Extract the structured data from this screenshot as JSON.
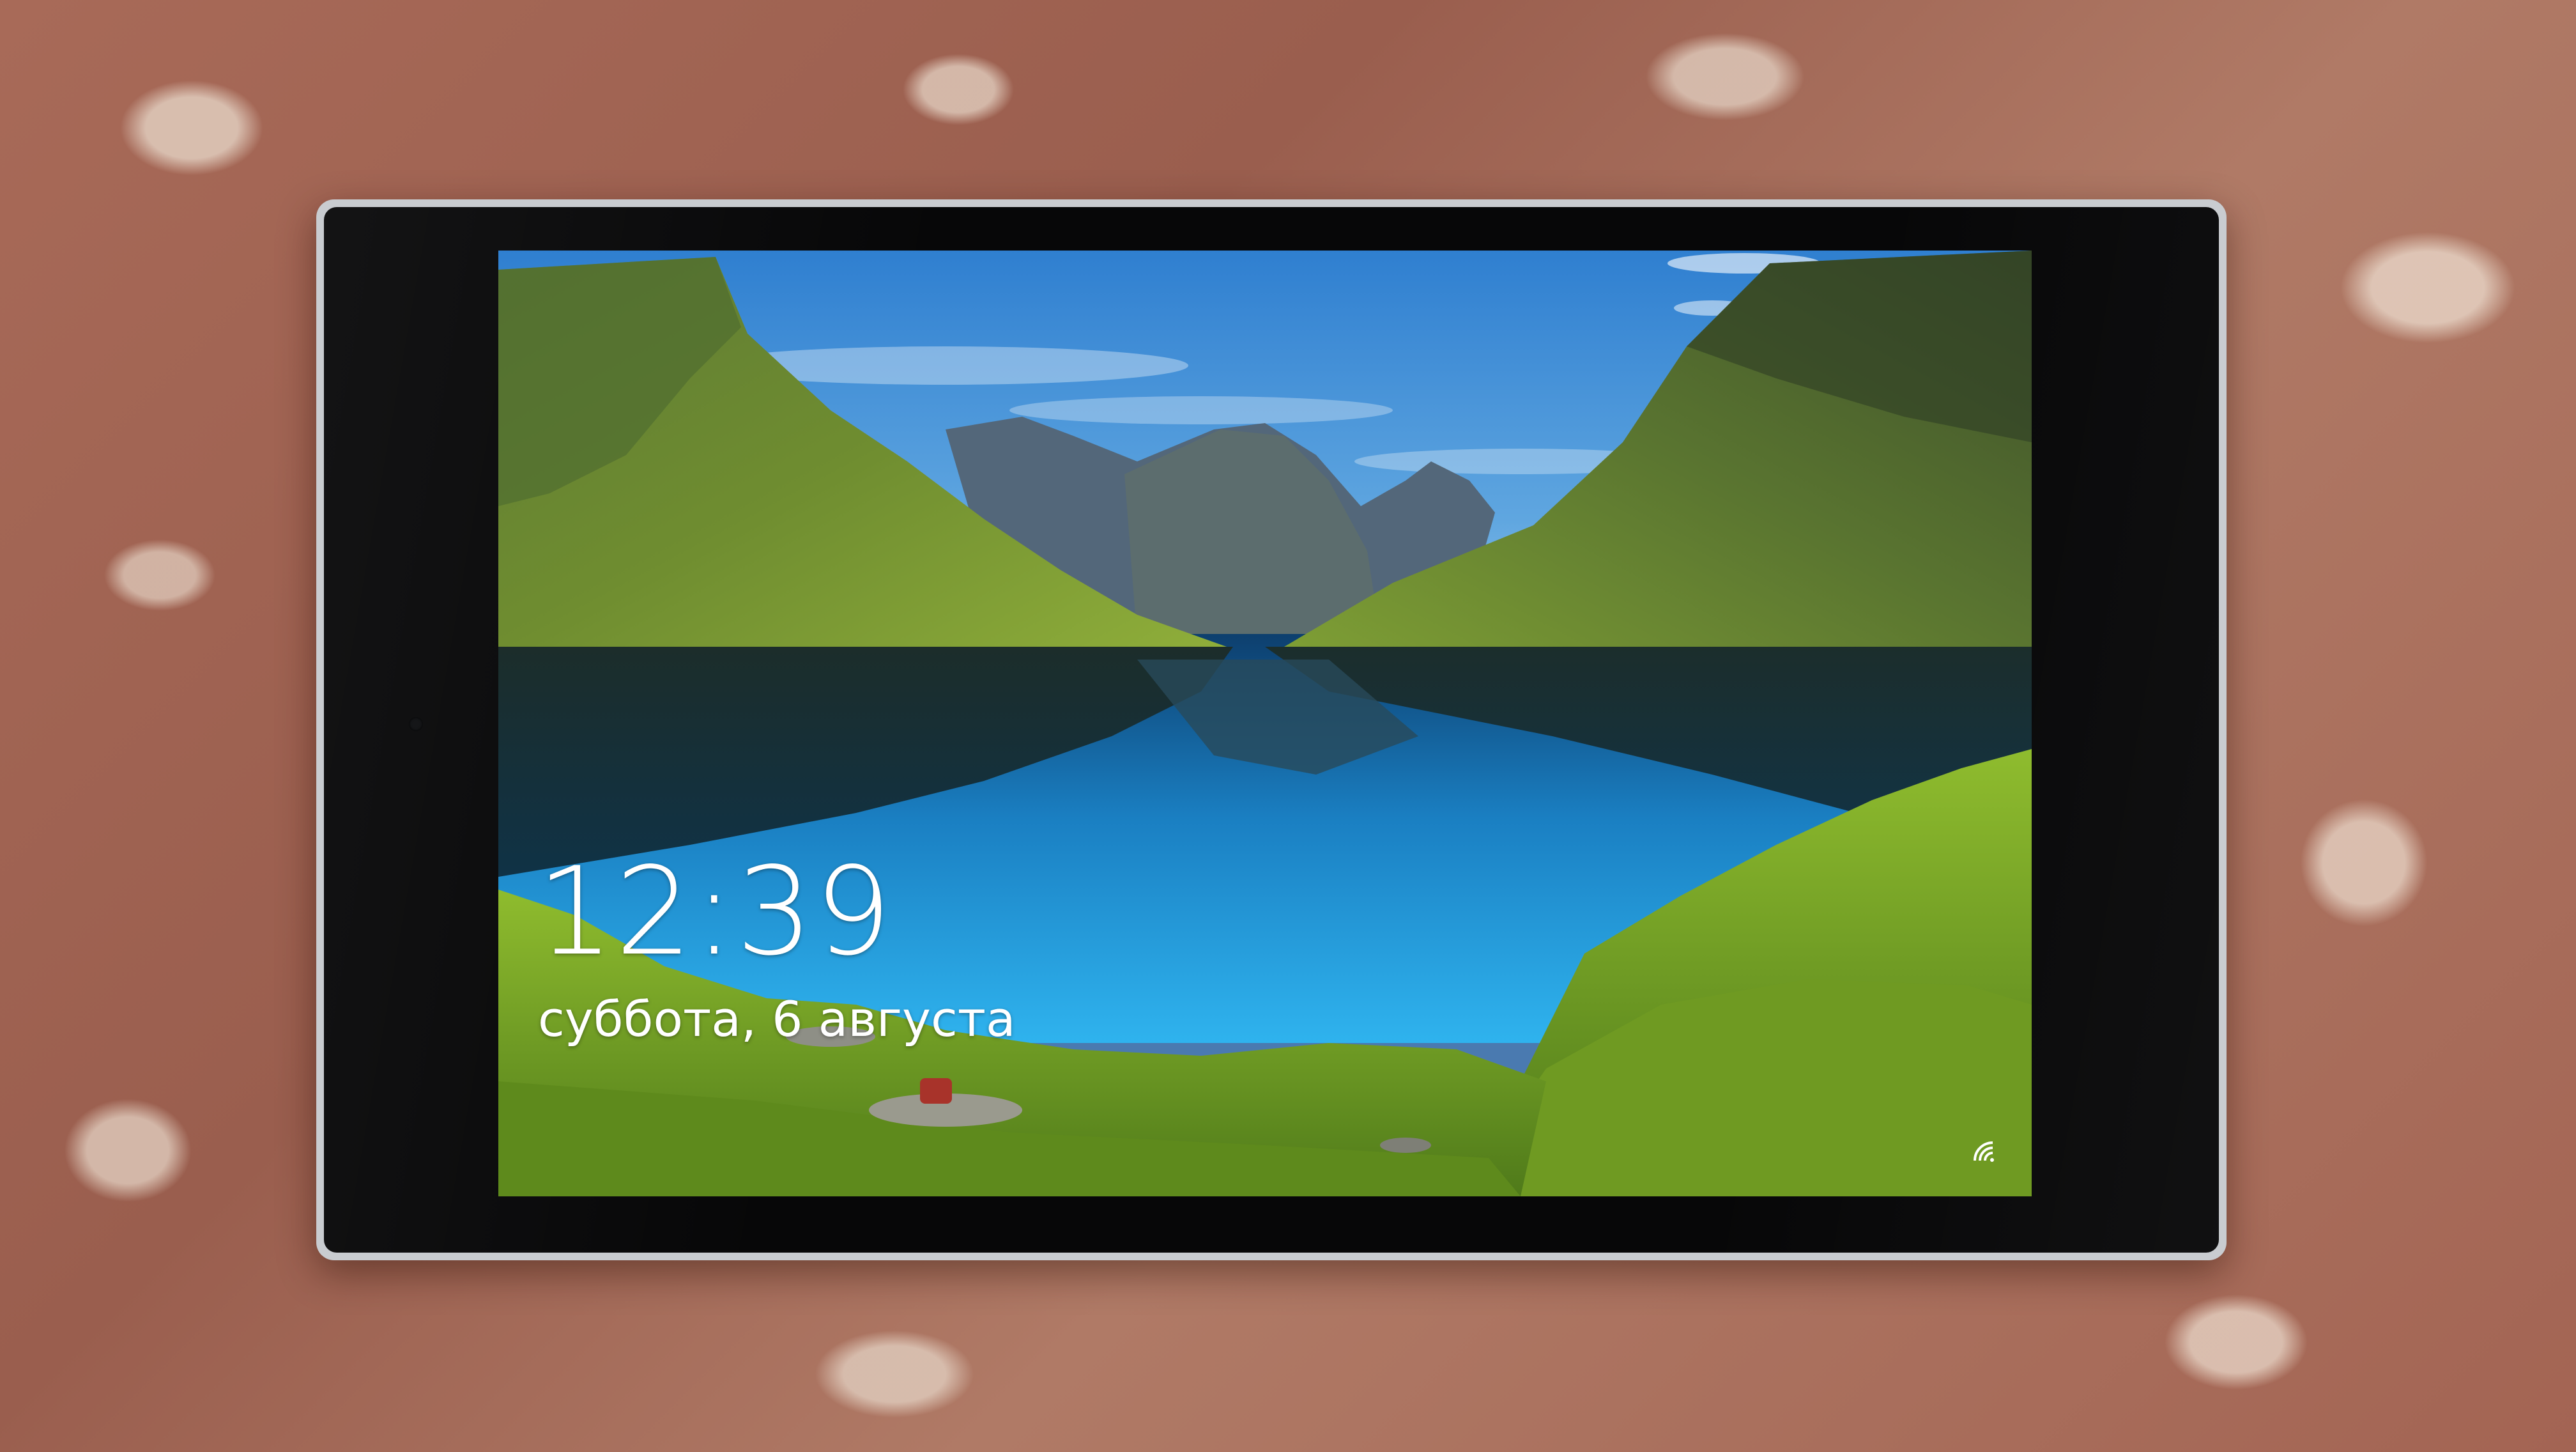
{
  "lock_screen": {
    "time": "12:39",
    "date": "суббота, 6 августа",
    "status_icon": "wifi-icon"
  },
  "colors": {
    "sky": "#3f8fd6",
    "lake": "#1e9ad8",
    "grass": "#7fae2a",
    "mountain": "#4f6b2f",
    "bezel": "#070708",
    "frame": "#c9ccd0"
  }
}
